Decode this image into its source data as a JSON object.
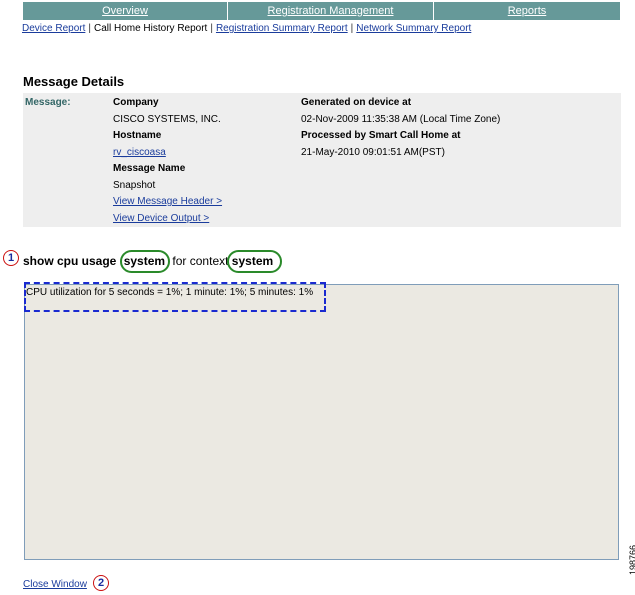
{
  "tabs": [
    "Overview",
    "Registration Management",
    "Reports"
  ],
  "subnav": {
    "device_report": "Device Report",
    "call_home_history": "Call Home History Report",
    "registration_summary": "Registration Summary Report",
    "network_summary": "Network Summary Report"
  },
  "section_title": "Message Details",
  "details": {
    "message_label": "Message:",
    "company_label": "Company",
    "company_value": "CISCO SYSTEMS, INC.",
    "hostname_label": "Hostname",
    "hostname_value": "rv_ciscoasa",
    "message_name_label": "Message Name",
    "message_name_value": "Snapshot",
    "view_header_link": "View Message Header >",
    "view_output_link": "View Device Output >",
    "generated_label": "Generated on device at",
    "generated_value": "02-Nov-2009 11:35:38 AM (Local Time Zone)",
    "processed_label": "Processed by Smart Call Home at",
    "processed_value": "21-May-2010 09:01:51 AM(PST)"
  },
  "command": {
    "prefix": "show cpu usage",
    "arg1": "system",
    "middle": "for context",
    "arg2": "system"
  },
  "output_text": "CPU utilization for 5 seconds = 1%; 1 minute: 1%; 5 minutes: 1%",
  "close_window": "Close Window",
  "callouts": {
    "one": "1",
    "two": "2"
  },
  "figure_number": "198766",
  "colors": {
    "tab_bg": "#669999",
    "oval": "#2a8a2a",
    "callout": "#cc1111",
    "dash": "#1a2ad0"
  }
}
